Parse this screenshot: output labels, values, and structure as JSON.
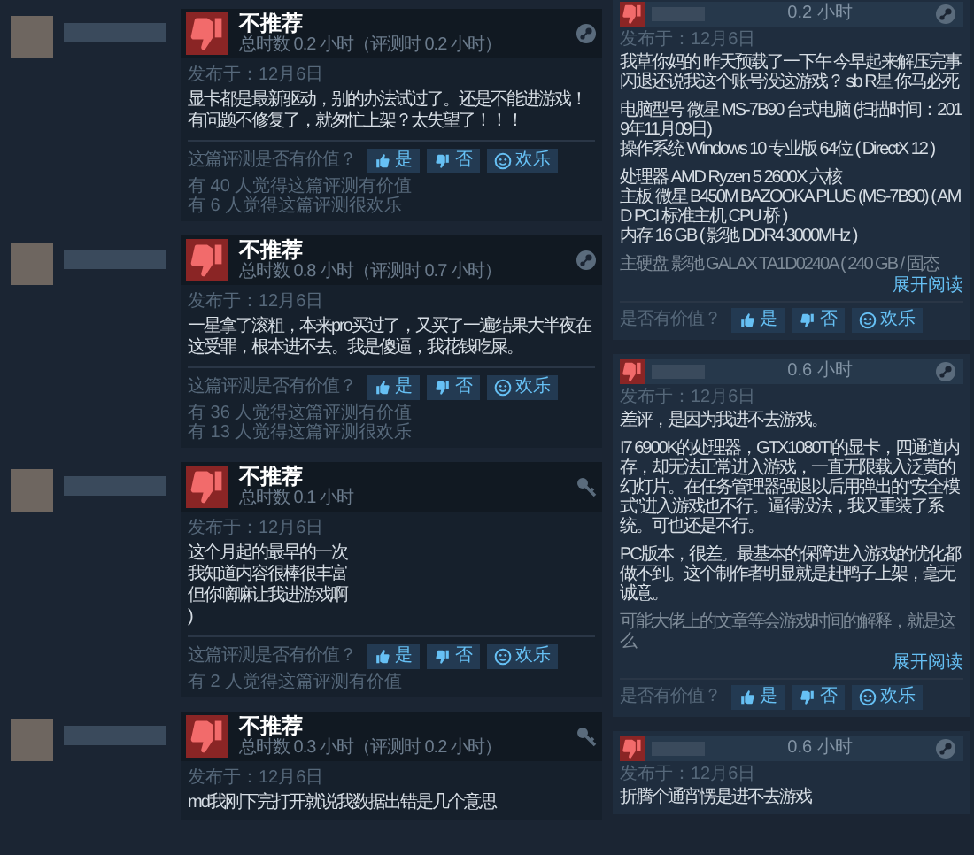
{
  "left_reviews": [
    {
      "kind": "steam",
      "verdict_label": "不推荐",
      "hours": "总时数 0.2 小时（评测时 0.2 小时）",
      "posted": "发布于：12月6日",
      "body": [
        "显卡都是最新驱动，别的办法试过了。还是不能进游戏！有问题不修复了，就匆忙上架？太失望了！！！"
      ],
      "prompt": "这篇评测是否有价值？",
      "buttons": [
        {
          "kind": "yes",
          "label": "是"
        },
        {
          "kind": "no",
          "label": "否"
        },
        {
          "kind": "funny",
          "label": "欢乐"
        }
      ],
      "stats": [
        "有 40 人觉得这篇评测有价值",
        "有 6 人觉得这篇评测很欢乐"
      ]
    },
    {
      "kind": "steam",
      "verdict_label": "不推荐",
      "hours": "总时数 0.8 小时（评测时 0.7 小时）",
      "posted": "发布于：12月6日",
      "body": [
        "一星拿了滚粗，本来pro买过了，又买了一遍结果大半夜在这受罪，根本进不去。我是傻逼，我花钱吃屎。"
      ],
      "prompt": "这篇评测是否有价值？",
      "buttons": [
        {
          "kind": "yes",
          "label": "是"
        },
        {
          "kind": "no",
          "label": "否"
        },
        {
          "kind": "funny",
          "label": "欢乐"
        }
      ],
      "stats": [
        "有 36 人觉得这篇评测有价值",
        "有 13 人觉得这篇评测很欢乐"
      ]
    },
    {
      "kind": "key",
      "verdict_label": "不推荐",
      "hours": "总时数 0.1 小时",
      "posted": "发布于：12月6日",
      "body": [
        "这个月起的最早的一次",
        "我知道内容很棒很丰富",
        "但你嘀嘛让我进游戏啊",
        ")"
      ],
      "prompt": "这篇评测是否有价值？",
      "buttons": [
        {
          "kind": "yes",
          "label": "是"
        },
        {
          "kind": "no",
          "label": "否"
        },
        {
          "kind": "funny",
          "label": "欢乐"
        }
      ],
      "stats": [
        "有 2 人觉得这篇评测有价值"
      ]
    },
    {
      "kind": "key",
      "verdict_label": "不推荐",
      "hours": "总时数 0.3 小时（评测时 0.2 小时）",
      "posted": "发布于：12月6日",
      "body": [
        "md我刚下完打开就说我数据出错是几个意思"
      ]
    }
  ],
  "right_reviews": [
    {
      "hours": "0.2 小时",
      "posted": "发布于：12月6日",
      "paragraphs": [
        [
          "我草你妈的 昨天预载了一下午 今早起来解压完事闪退还说我这个账号没这游戏？ sb R星 你马必死"
        ],
        [
          "电脑型号 微星 MS-7B90 台式电脑 (扫描时间：2019年11月09日)",
          "操作系统 Windows 10 专业版 64位 ( DirectX 12 )"
        ],
        [
          "处理器 AMD Ryzen 5 2600X 六核",
          "主板 微星 B450M BAZOOKA PLUS (MS-7B90) ( AMD PCI 标准主机 CPU 桥 )",
          "内存 16 GB ( 影驰 DDR4 3000MHz )"
        ]
      ],
      "faded": "主硬盘 影驰 GALAX TA1D0240A ( 240 GB / 固态",
      "expand": "展开阅读",
      "prompt": "是否有价值？",
      "buttons": [
        {
          "kind": "yes",
          "label": "是"
        },
        {
          "kind": "no",
          "label": "否"
        },
        {
          "kind": "funny",
          "label": "欢乐"
        }
      ]
    },
    {
      "hours": "0.6 小时",
      "posted": "发布于：12月6日",
      "paragraphs": [
        [
          "差评，是因为我进不去游戏。"
        ],
        [
          "I7 6900K的处理器，GTX1080TI的显卡，四通道内存，却无法正常进入游戏，一直无限载入泛黄的幻灯片。在任务管理器强退以后用弹出的“安全模式”进入游戏也不行。逼得没法，我又重装了系统。可也还是不行。"
        ],
        [
          "PC版本，很差。最基本的保障进入游戏的优化都做不到。这个制作者明显就是赶鸭子上架，毫无诚意。"
        ]
      ],
      "faded": "可能大佬上的文章等会游戏时间的解释，就是这么",
      "expand": "展开阅读",
      "prompt": "是否有价值？",
      "buttons": [
        {
          "kind": "yes",
          "label": "是"
        },
        {
          "kind": "no",
          "label": "否"
        },
        {
          "kind": "funny",
          "label": "欢乐"
        }
      ]
    },
    {
      "hours": "0.6 小时",
      "posted": "发布于：12月6日",
      "paragraphs": [
        [
          "折腾个通宵愣是进不去游戏"
        ]
      ]
    }
  ]
}
